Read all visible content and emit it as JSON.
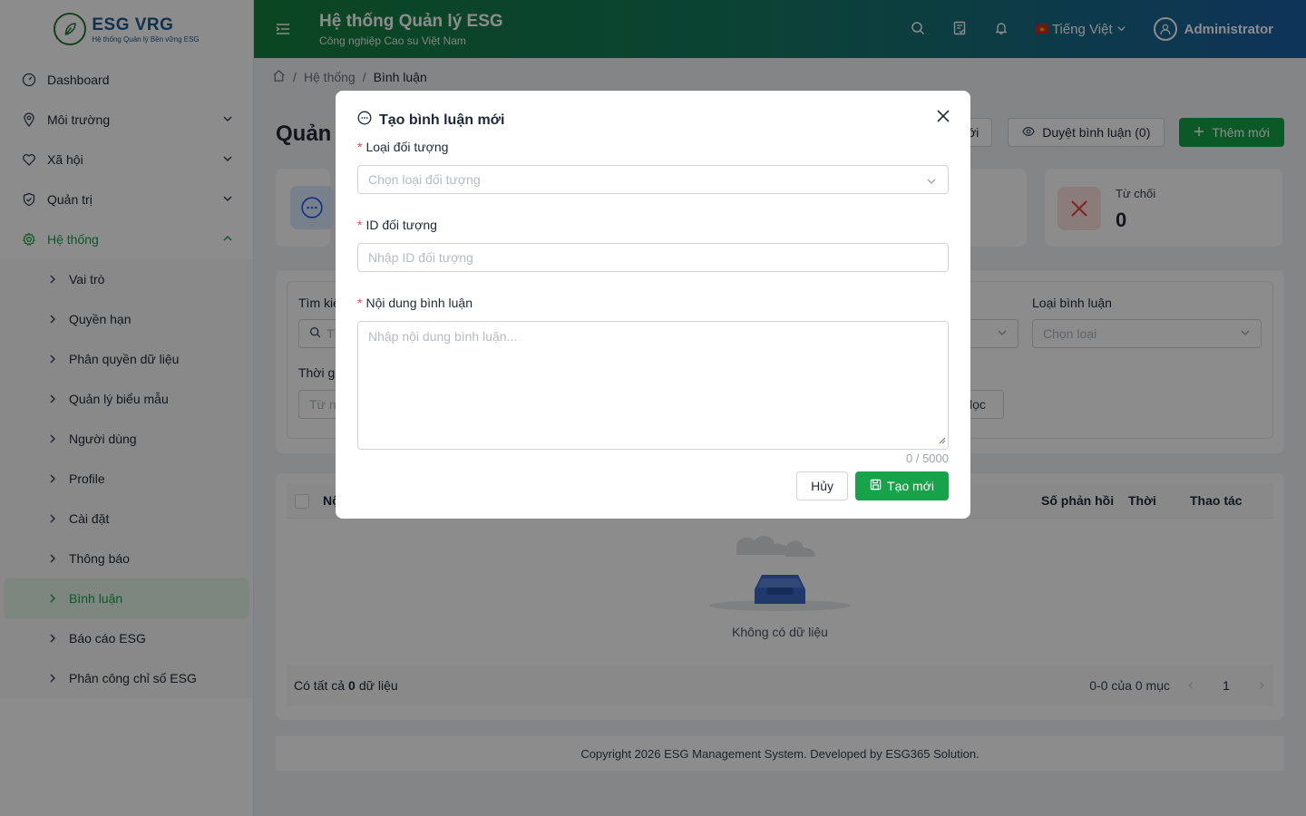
{
  "brand": {
    "title": "ESG VRG",
    "subtitle": "Hệ thống Quản lý Bền vững ESG"
  },
  "header": {
    "title": "Hệ thống Quản lý ESG",
    "subtitle": "Công nghiệp Cao su Việt Nam",
    "language": "Tiếng Việt",
    "user": "Administrator"
  },
  "sidebar": {
    "items": [
      {
        "label": "Dashboard"
      },
      {
        "label": "Môi trường"
      },
      {
        "label": "Xã hội"
      },
      {
        "label": "Quản trị"
      },
      {
        "label": "Hệ thống"
      }
    ],
    "sub_items": [
      {
        "label": "Vai trò"
      },
      {
        "label": "Quyền hạn"
      },
      {
        "label": "Phân quyền dữ liệu"
      },
      {
        "label": "Quản lý biểu mẫu"
      },
      {
        "label": "Người dùng"
      },
      {
        "label": "Profile"
      },
      {
        "label": "Cài đặt"
      },
      {
        "label": "Thông báo"
      },
      {
        "label": "Bình luận"
      },
      {
        "label": "Báo cáo ESG"
      },
      {
        "label": "Phân công chỉ số ESG"
      }
    ]
  },
  "breadcrumb": {
    "parent": "Hệ thống",
    "current": "Bình luận"
  },
  "page": {
    "title": "Quản",
    "partial_btn": "ới",
    "review_btn": "Duyệt bình luận (0)",
    "add_btn": "Thêm mới"
  },
  "stats": {
    "reject_label": "Từ chối",
    "reject_value": "0"
  },
  "filters": {
    "search_label": "Tìm kiế",
    "search_placeholder": "Tì",
    "time_label": "Thời gi",
    "date_placeholder": "Từ n",
    "type_label": "Loại bình luận",
    "type_placeholder": "Chọn loại",
    "filter_btn_partial": "lọc"
  },
  "table": {
    "col_content_partial": "Nộ",
    "col_replies": "Số phản hồi",
    "col_time": "Thời",
    "col_actions": "Thao tác",
    "empty_text": "Không có dữ liệu",
    "total_prefix": "Có tất cả",
    "total_count": "0",
    "total_suffix": "dữ liệu",
    "range_text": "0-0 của 0 mục",
    "page": "1"
  },
  "footer": {
    "text": "Copyright 2026 ESG Management System. Developed by ESG365 Solution."
  },
  "modal": {
    "title": "Tạo bình luận mới",
    "object_type_label": "Loại đối tượng",
    "object_type_placeholder": "Chọn loại đối tượng",
    "object_id_label": "ID đối tượng",
    "object_id_placeholder": "Nhập ID đối tượng",
    "content_label": "Nội dung bình luận",
    "content_placeholder": "Nhập nội dung bình luận...",
    "counter": "0 / 5000",
    "cancel_label": "Hủy",
    "create_label": "Tạo mới"
  },
  "colors": {
    "primary": "#16a34a",
    "header_start": "#15803d",
    "header_end": "#1b5fa3",
    "danger": "#ef4444"
  }
}
